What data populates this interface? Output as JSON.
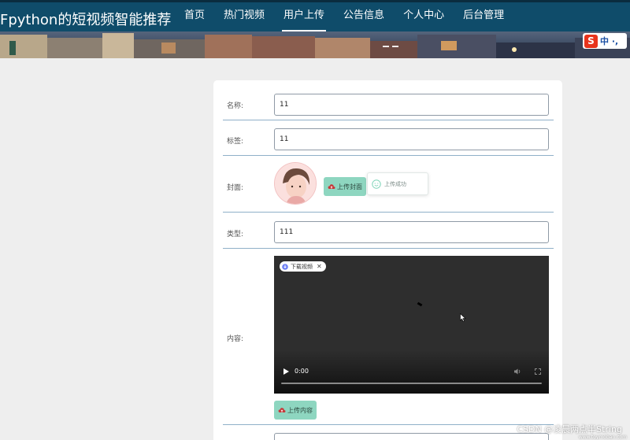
{
  "header": {
    "title": "Fpython的短视频智能推荐",
    "nav": [
      {
        "label": "首页",
        "active": false
      },
      {
        "label": "热门视频",
        "active": false
      },
      {
        "label": "用户上传",
        "active": true
      },
      {
        "label": "公告信息",
        "active": false
      },
      {
        "label": "个人中心",
        "active": false
      },
      {
        "label": "后台管理",
        "active": false
      }
    ]
  },
  "ime": {
    "label": "中 ·,"
  },
  "form": {
    "name": {
      "label": "名称:",
      "value": "11"
    },
    "tags": {
      "label": "标签:",
      "value": "11"
    },
    "cover": {
      "label": "封面:",
      "upload_button": "上传封面",
      "toast": "上传成功"
    },
    "type": {
      "label": "类型:",
      "value": "111"
    },
    "content": {
      "label": "内容:",
      "download_badge": "下载视频",
      "current_time": "0:00",
      "upload_button": "上传内容"
    }
  },
  "watermark": {
    "text": "CSDN @凌晨两点半String",
    "url": "www.toymoban.com"
  },
  "colors": {
    "topbar": "#0f4c6a",
    "upload_button": "#8ed6c0",
    "page_bg": "#eeeeee"
  }
}
